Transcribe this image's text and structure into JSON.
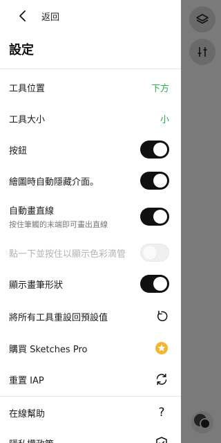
{
  "header": {
    "back_label": "返回",
    "title": "設定"
  },
  "settings": {
    "tool_position": {
      "label": "工具位置",
      "value": "下方"
    },
    "tool_size": {
      "label": "工具大小",
      "value": "小"
    },
    "buttons": {
      "label": "按鈕",
      "state": "on"
    },
    "auto_hide": {
      "label": "繪圖時自動隱藏介面。",
      "state": "on"
    },
    "auto_line": {
      "label": "自動畫直線",
      "sub": "按住筆觸的末端即可畫出直線",
      "state": "on"
    },
    "eyedropper": {
      "label": "點一下並按住以顯示色彩滴管",
      "state": "off-disabled"
    },
    "brush_shape": {
      "label": "顯示畫筆形狀",
      "state": "on"
    },
    "reset_tools": {
      "label": "將所有工具重設回預設值",
      "icon": "reset-icon"
    },
    "buy_pro": {
      "label": "購買 Sketches Pro",
      "icon": "star-icon"
    },
    "reset_iap": {
      "label": "重置 IAP",
      "icon": "refresh-icon"
    },
    "help": {
      "label": "在線幫助",
      "icon": "question-icon"
    },
    "privacy": {
      "label": "隱私權政策",
      "icon": "shield-icon"
    }
  },
  "colors": {
    "accent_green": "#2fa84f",
    "star_gold": "#f2b632",
    "toggle_on": "#111111"
  }
}
